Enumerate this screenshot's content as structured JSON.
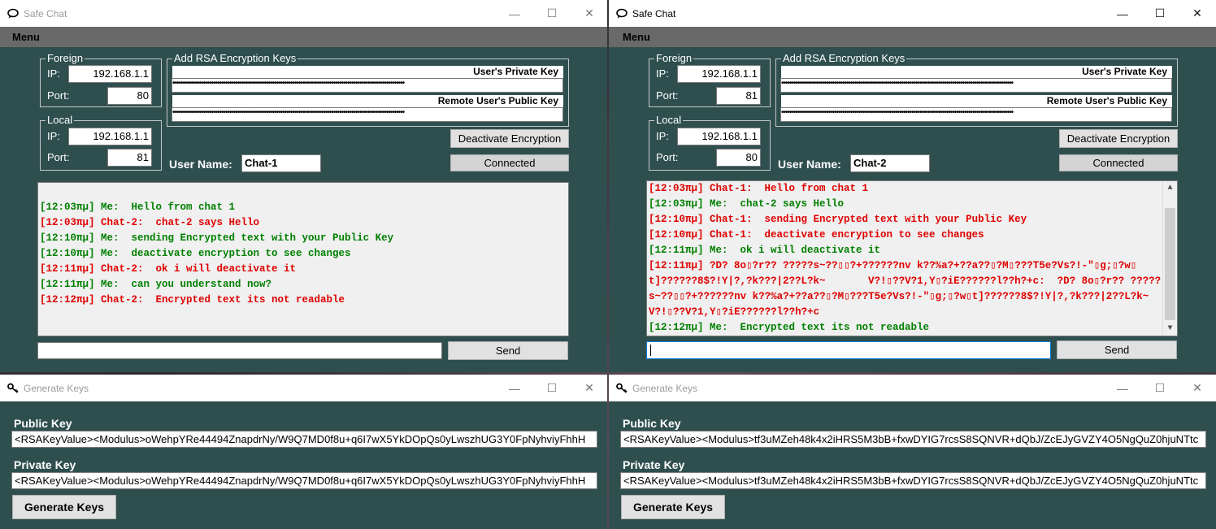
{
  "chat_left": {
    "title": "Safe Chat",
    "menu": "Menu",
    "foreign": {
      "group": "Foreign",
      "ip_label": "IP:",
      "ip": "192.168.1.1",
      "port_label": "Port:",
      "port": "80"
    },
    "local": {
      "group": "Local",
      "ip_label": "IP:",
      "ip": "192.168.1.1",
      "port_label": "Port:",
      "port": "81"
    },
    "rsa": {
      "group": "Add RSA Encryption Keys",
      "private_label": "User's Private Key",
      "public_label": "Remote User's Public Key",
      "private_dots": "••••••••••••••••••••••••••••••••••••••••••••••••••••••••••••••••••••••••••••••••••••••••••••••••••••••••••••••••••",
      "public_dots": "••••••••••••••••••••••••••••••••••••••••••••••••••••••••••••••••••••••••••••••••••••••••••••••••••••••••••••••••••"
    },
    "deactivate_label": "Deactivate Encryption",
    "status_label": "Connected",
    "username_label": "User Name:",
    "username": "Chat-1",
    "messages": [
      {
        "text": "",
        "color": "#008000"
      },
      {
        "text": "[12:03πμ] Me:  Hello from chat 1",
        "color": "#008000"
      },
      {
        "text": "[12:03πμ] Chat-2:  chat-2 says Hello",
        "color": "#e00000"
      },
      {
        "text": "[12:10πμ] Me:  sending Encrypted text with your Public Key",
        "color": "#008000"
      },
      {
        "text": "[12:10πμ] Me:  deactivate encryption to see changes",
        "color": "#008000"
      },
      {
        "text": "[12:11πμ] Chat-2:  ok i will deactivate it",
        "color": "#e00000"
      },
      {
        "text": "[12:11πμ] Me:  can you understand now?",
        "color": "#008000"
      },
      {
        "text": "[12:12πμ] Chat-2:  Encrypted text its not readable",
        "color": "#e00000"
      }
    ],
    "input_value": "",
    "send_label": "Send"
  },
  "chat_right": {
    "title": "Safe Chat",
    "menu": "Menu",
    "foreign": {
      "group": "Foreign",
      "ip_label": "IP:",
      "ip": "192.168.1.1",
      "port_label": "Port:",
      "port": "81"
    },
    "local": {
      "group": "Local",
      "ip_label": "IP:",
      "ip": "192.168.1.1",
      "port_label": "Port:",
      "port": "80"
    },
    "rsa": {
      "group": "Add RSA Encryption Keys",
      "private_label": "User's Private Key",
      "public_label": "Remote User's Public Key",
      "private_dots": "••••••••••••••••••••••••••••••••••••••••••••••••••••••••••••••••••••••••••••••••••••••••••••••••••••••••••••••••••",
      "public_dots": "••••••••••••••••••••••••••••••••••••••••••••••••••••••••••••••••••••••••••••••••••••••••••••••••••••••••••••••••••"
    },
    "deactivate_label": "Deactivate Encryption",
    "status_label": "Connected",
    "username_label": "User Name:",
    "username": "Chat-2",
    "messages": [
      {
        "text": "[12:03πμ] Chat-1:  Hello from chat 1",
        "color": "#e00000"
      },
      {
        "text": "[12:03πμ] Me:  chat-2 says Hello",
        "color": "#008000"
      },
      {
        "text": "[12:10πμ] Chat-1:  sending Encrypted text with your Public Key",
        "color": "#e00000"
      },
      {
        "text": "[12:10πμ] Chat-1:  deactivate encryption to see changes",
        "color": "#e00000"
      },
      {
        "text": "[12:11πμ] Me:  ok i will deactivate it",
        "color": "#008000"
      },
      {
        "text": "[12:11πμ] ?D? 8o▯?r?? ?????s~??▯▯?+??????nv k??%a?+??a??▯?M▯???T5e?Vs?!-\"▯g;▯?w▯t]??????8$?!Y|?,?k???|2??L?k~       V?!▯??V?1,Y▯?iE??????l??h?+c:  ?D? 8o▯?r?? ?????s~??▯▯?+??????nv k??%a?+??a??▯?M▯???T5e?Vs?!-\"▯g;▯?w▯t]??????8$?!Y|?,?k???|2??L?k~V?!▯??V?1,Y▯?iE??????l??h?+c",
        "color": "#e00000"
      },
      {
        "text": "[12:12πμ] Me:  Encrypted text its not readable",
        "color": "#008000"
      }
    ],
    "input_value": "",
    "send_label": "Send"
  },
  "keys_left": {
    "title": "Generate Keys",
    "public_label": "Public Key",
    "public_value": "<RSAKeyValue><Modulus>oWehpYRe44494ZnapdrNy/W9Q7MD0f8u+q6I7wX5YkDOpQs0yLwszhUG3Y0FpNyhviyFhhH",
    "private_label": "Private Key",
    "private_value": "<RSAKeyValue><Modulus>oWehpYRe44494ZnapdrNy/W9Q7MD0f8u+q6I7wX5YkDOpQs0yLwszhUG3Y0FpNyhviyFhhH",
    "generate_label": "Generate Keys"
  },
  "keys_right": {
    "title": "Generate Keys",
    "public_label": "Public Key",
    "public_value": "<RSAKeyValue><Modulus>tf3uMZeh48k4x2iHRS5M3bB+fxwDYIG7rcsS8SQNVR+dQbJ/ZcEJyGVZY4O5NgQuZ0hjuNTtc",
    "private_label": "Private Key",
    "private_value": "<RSAKeyValue><Modulus>tf3uMZeh48k4x2iHRS5M3bB+fxwDYIG7rcsS8SQNVR+dQbJ/ZcEJyGVZY4O5NgQuZ0hjuNTtc",
    "generate_label": "Generate Keys"
  },
  "window_controls": {
    "minimize": "—",
    "maximize": "☐",
    "close": "✕"
  },
  "scroll": {
    "up": "▲",
    "down": "▼"
  }
}
